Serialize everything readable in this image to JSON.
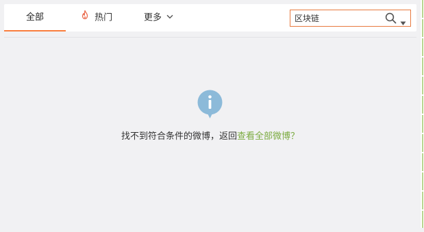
{
  "tabs": {
    "all_label": "全部",
    "hot_label": "热门",
    "more_label": "更多"
  },
  "search": {
    "value": "区块链"
  },
  "empty_state": {
    "message": "找不到符合条件的微博，返回",
    "link_text": "查看全部微博",
    "suffix": "？"
  },
  "colors": {
    "accent": "#fa7d3c",
    "link": "#7bab40",
    "info_icon": "#8cbad9"
  },
  "icons": {
    "hot": "fire-icon",
    "more": "chevron-down-icon",
    "search": "search-icon",
    "dropdown": "dropdown-caret-icon",
    "empty": "info-icon"
  }
}
